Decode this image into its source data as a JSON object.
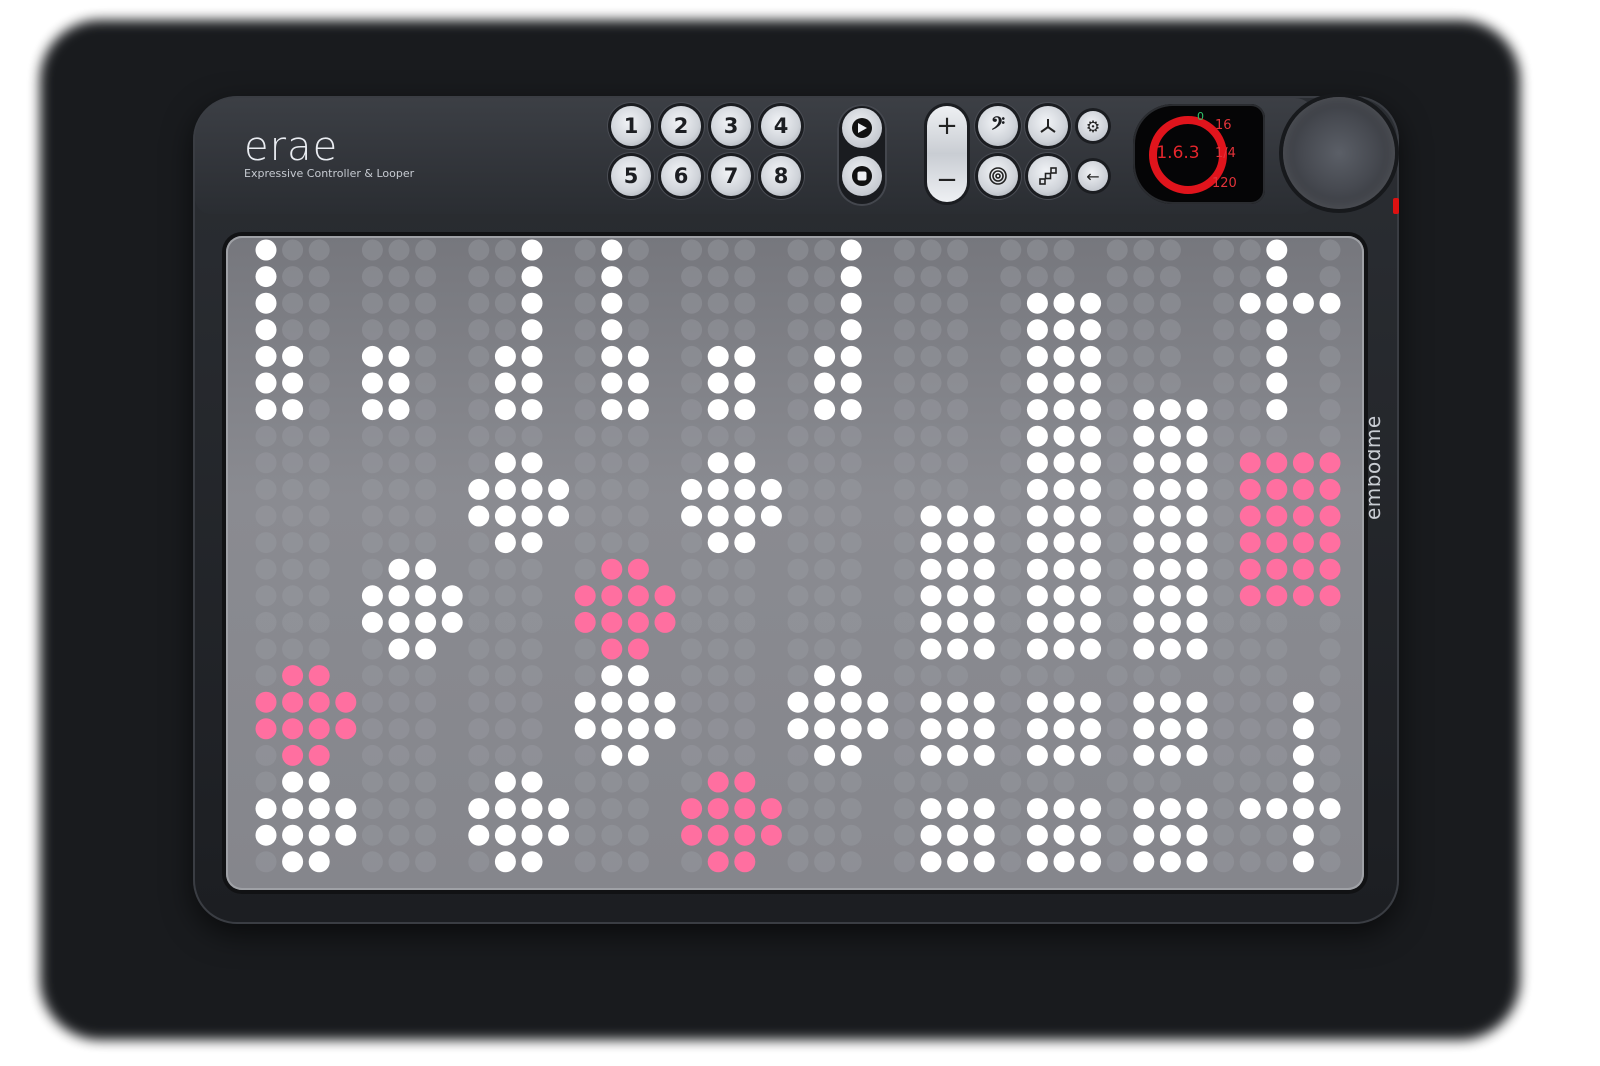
{
  "device": {
    "logo": "erae",
    "tagline": "Expressive Controller & Looper",
    "brand_vertical": "embodme"
  },
  "buttons": {
    "number_buttons": [
      "1",
      "2",
      "3",
      "4",
      "5",
      "6",
      "7",
      "8"
    ],
    "play_icon": "play-icon",
    "stop_icon": "stop-icon",
    "plus_label": "+",
    "minus_label": "−",
    "bass_clef_icon": "bass-clef-icon",
    "tripod_icon": "tripod-icon",
    "spiral_icon": "spiral-icon",
    "steps_icon": "steps-icon",
    "settings_icon": "gear-icon",
    "back_icon": "arrow-left-icon"
  },
  "display": {
    "ring_value": "1.6.3",
    "badge": "0",
    "bars": "16",
    "signature": "1/4",
    "tempo": "120",
    "accent_color": "#e0141c"
  }
}
